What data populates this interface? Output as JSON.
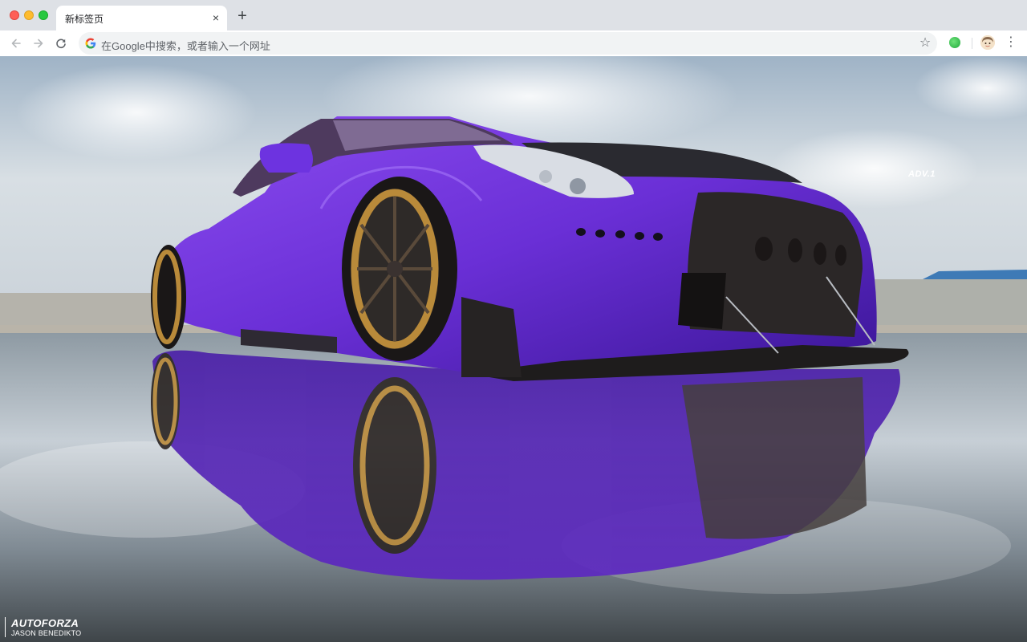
{
  "browser": {
    "tab": {
      "title": "新标签页",
      "close_glyph": "×"
    },
    "new_tab_glyph": "+",
    "omnibox": {
      "placeholder": "在Google中搜索，或者输入一个网址"
    },
    "icons": [
      "back-icon",
      "forward-icon",
      "reload-icon",
      "google-g-icon",
      "bookmark-star-icon",
      "extension-icon",
      "profile-avatar-icon",
      "menu-icon"
    ]
  },
  "wallpaper": {
    "subject": "purple-sports-car",
    "watermark": "ADV.1",
    "credit": {
      "title": "AUTOFORZA",
      "subtitle": "JASON BENEDIKTO"
    }
  },
  "colors": {
    "tab_strip": "#dee1e6",
    "toolbar": "#ffffff",
    "omnibox": "#f1f3f4",
    "car_body": "#6a2fd6",
    "wheel_rim": "#b98a3a"
  }
}
